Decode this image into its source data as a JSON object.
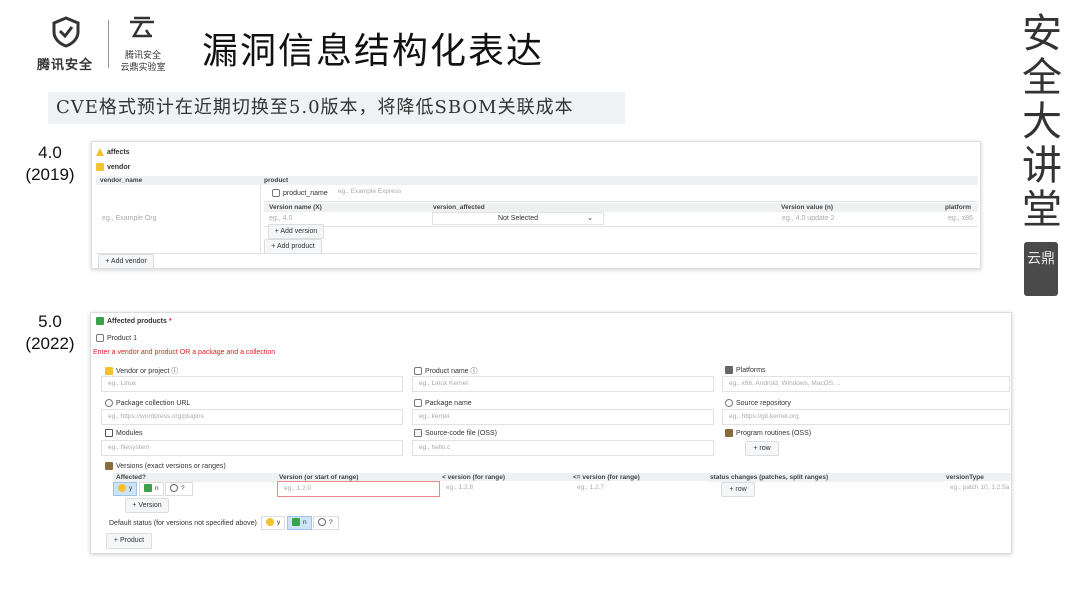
{
  "header": {
    "logo_text": "腾讯安全",
    "lab_line1": "腾讯安全",
    "lab_line2": "云鼎实验室",
    "title": "漏洞信息结构化表达",
    "calligraphy": [
      "安",
      "全",
      "大",
      "讲",
      "堂"
    ],
    "seal_text": "云鼎"
  },
  "banner": "CVE格式预计在近期切换至5.0版本，将降低SBOM关联成本",
  "v4": {
    "label_version": "4.0",
    "label_year": "(2019)",
    "affects": "affects",
    "vendor": "vendor",
    "col_vendor_name": "vendor_name",
    "col_product": "product",
    "vendor_placeholder": "eg., Example Org",
    "product_name_label": "product_name",
    "product_name_placeholder": "eg., Example Express",
    "col_version_name": "Version name (X)",
    "col_version_affected": "version_affected",
    "col_version_value": "Version value (n)",
    "col_platform": "platform",
    "version_name_placeholder": "eg., 4.0",
    "version_affected_value": "Not Selected",
    "version_value_placeholder": "eg., 4.0 update 2",
    "platform_placeholder": "eg., x86",
    "add_version": "+ Add version",
    "add_product": "+ Add product",
    "add_vendor": "+ Add vendor"
  },
  "v5": {
    "label_version": "5.0",
    "label_year": "(2022)",
    "affected_products": "Affected products",
    "required_star": "*",
    "product_1": "Product 1",
    "error_msg": "Enter a vendor and product OR a package and a collection",
    "vendor_label": "Vendor or project ⓘ",
    "vendor_placeholder": "eg., Linux",
    "product_label": "Product name ⓘ",
    "product_placeholder": "eg., Linux Kernel",
    "platforms_label": "Platforms",
    "platforms_placeholder": "eg., x86, Android, Windows, MacOS, ..",
    "collection_label": "Package collection URL",
    "collection_placeholder": "eg., https://wordpress.org/plugins",
    "package_label": "Package name",
    "package_placeholder": "eg., kernel",
    "repo_label": "Source repository",
    "repo_placeholder": "eg., https://git.kernel.org",
    "modules_label": "Modules",
    "modules_placeholder": "eg., filesystem",
    "source_file_label": "Source-code file (OSS)",
    "source_file_placeholder": "eg., hello.c",
    "routines_label": "Program routines (OSS)",
    "row_btn": "+ row",
    "versions_label": "Versions (exact versions or ranges)",
    "col_affected": "Affected?",
    "col_version_start": "Version (or start of range)",
    "col_lt": "< version (for range)",
    "col_lte": "<= version (for range)",
    "col_status_changes": "status changes (patches, split ranges)",
    "col_version_type": "versionType",
    "opt_y": "y",
    "opt_n": "n",
    "opt_q": "?",
    "version_start_placeholder": "eg., 1.2.0",
    "lt_placeholder": "eg., 1.2.8",
    "lte_placeholder": "eg., 1.2.7",
    "version_type_placeholder": "eg., patch 10, 1.2.5a",
    "add_version": "+ Version",
    "default_status_label": "Default status (for versions not specified above)",
    "add_product": "+ Product"
  }
}
